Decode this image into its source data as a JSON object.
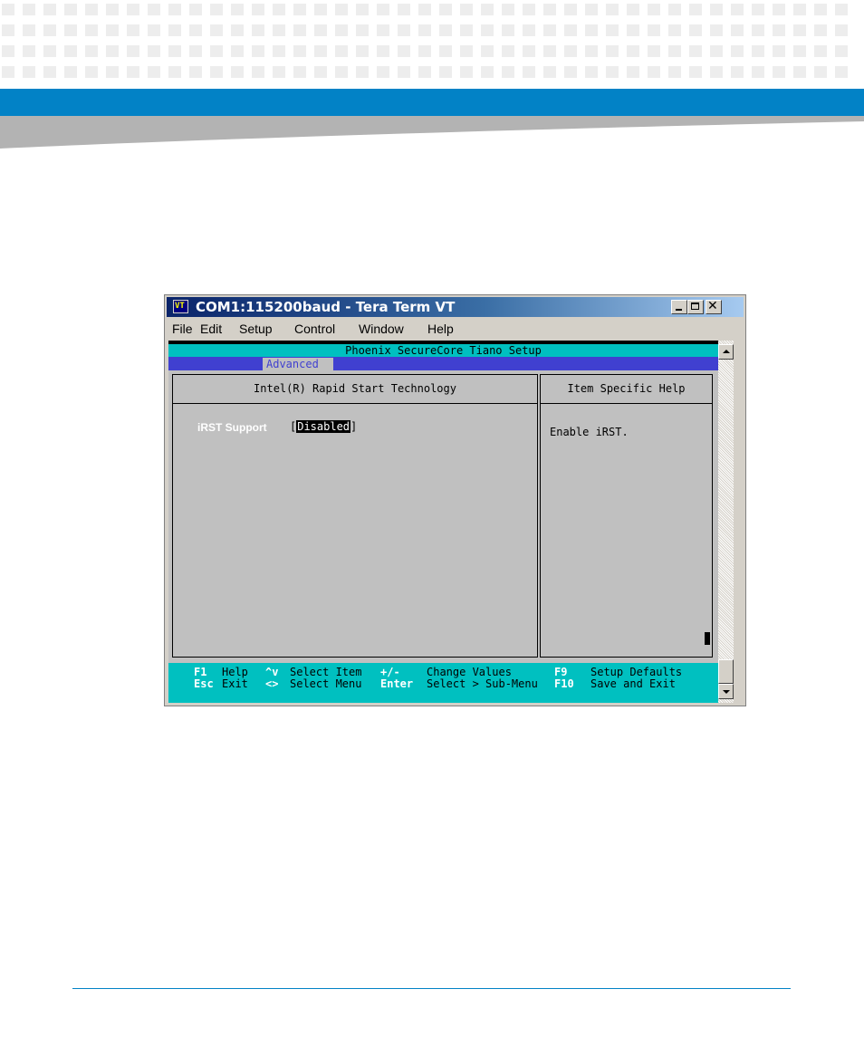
{
  "window": {
    "title": "COM1:115200baud - Tera Term VT",
    "icon": "tera-term-vt-icon",
    "icon_text": "VT"
  },
  "menu": {
    "items": [
      {
        "label": "File"
      },
      {
        "label": "Edit"
      },
      {
        "label": "Setup"
      },
      {
        "label": "Control"
      },
      {
        "label": "Window"
      },
      {
        "label": "Help"
      }
    ]
  },
  "bios": {
    "title": "Phoenix SecureCore Tiano Setup",
    "active_tab": "Advanced",
    "section_title": "Intel(R) Rapid Start Technology",
    "help_title": "Item Specific Help",
    "setting_label": "iRST Support",
    "setting_open_bracket": "[",
    "setting_value": "Disabled",
    "setting_close_bracket": "]",
    "help_text": "Enable iRST."
  },
  "footer": {
    "keys": [
      {
        "key": "F1",
        "desc": "Help"
      },
      {
        "key": "^v",
        "desc": "Select Item"
      },
      {
        "key": "+/-",
        "desc": "Change Values"
      },
      {
        "key": "F9",
        "desc": "Setup Defaults"
      },
      {
        "key": "Esc",
        "desc": "Exit"
      },
      {
        "key": "<>",
        "desc": "Select Menu"
      },
      {
        "key": "Enter",
        "desc": "Select > Sub-Menu"
      },
      {
        "key": "F10",
        "desc": "Save and Exit"
      }
    ]
  },
  "colors": {
    "brand_blue": "#0282c6",
    "bios_cyan": "#00c0c0",
    "bios_blue": "#4040d0",
    "bios_gray": "#c0c0c0"
  }
}
